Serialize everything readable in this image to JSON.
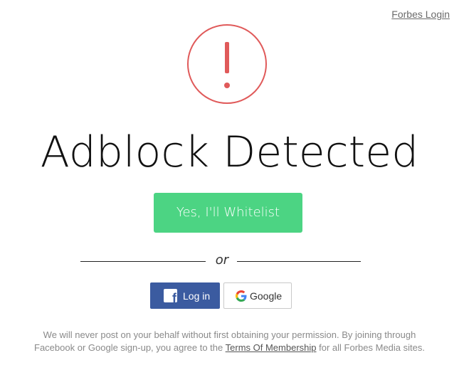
{
  "header": {
    "login_link": "Forbes Login"
  },
  "alert": {
    "icon": "exclamation-icon",
    "color": "#e05a5a"
  },
  "headline": "Adblock Detected",
  "actions": {
    "whitelist_label": "Yes, I'll Whitelist",
    "whitelist_color": "#4cd483",
    "or_label": "or",
    "facebook_label": "Log in",
    "facebook_color": "#3b5ba0",
    "google_label": "Google"
  },
  "disclaimer": {
    "line1": "We will never post on your behalf without first obtaining your permission. By joining through",
    "line2_prefix": "Facebook or Google sign-up, you agree to the",
    "terms_link": "Terms Of Membership",
    "line2_suffix": "for all Forbes Media sites."
  }
}
